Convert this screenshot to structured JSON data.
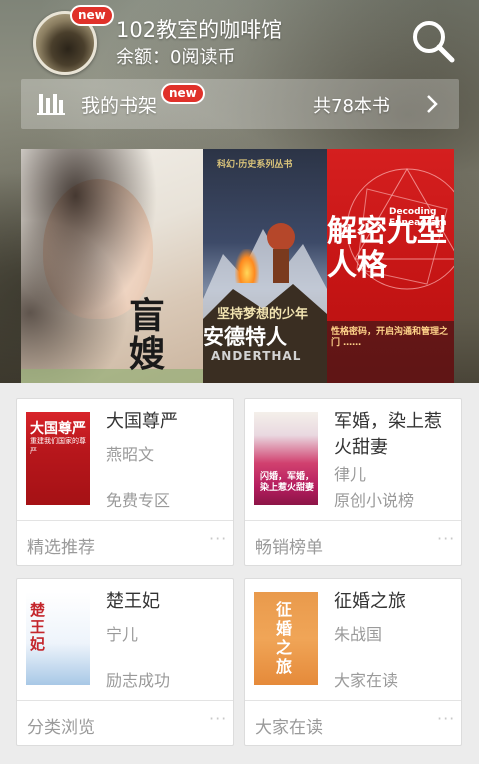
{
  "header": {
    "badge_new": "new",
    "user_name": "102教室的咖啡馆",
    "balance": "余额：0阅读币"
  },
  "shelf": {
    "label": "我的书架",
    "badge_new": "new",
    "count": "共78本书"
  },
  "covers": [
    {
      "title": "盲嫂"
    },
    {
      "top": "科幻·历史系列丛书",
      "motto": "坚持梦想的少年",
      "title": "安德特人",
      "sub": "ANDERTHAL"
    },
    {
      "title": "解密九型人格",
      "en": "Decoding Enneagram",
      "text": "性格密码，开启沟通和管理之门 ……"
    }
  ],
  "cards": [
    {
      "title": "大国尊严",
      "author": "燕昭文",
      "tag": "免费专区",
      "section": "精选推荐",
      "book_text": "大国尊严",
      "book_sub": "重建我们国家的尊严"
    },
    {
      "title": "军婚，染上惹火甜妻",
      "author": "律儿",
      "tag": "原创小说榜",
      "section": "畅销榜单",
      "book_text": "闪婚，军婚，染上惹火甜妻"
    },
    {
      "title": "楚王妃",
      "author": "宁儿",
      "tag": "励志成功",
      "section": "分类浏览",
      "book_text": "楚王妃"
    },
    {
      "title": "征婚之旅",
      "author": "朱战国",
      "tag": "大家在读",
      "section": "大家在读",
      "book_text": "征婚之旅"
    }
  ],
  "more_label": "···",
  "colors": {
    "badge": "#e0312a",
    "muted_text": "#9a9a9a",
    "card_bg": "#ffffff",
    "page_bg": "#ececec"
  },
  "icons": [
    "search-icon",
    "bookshelf-icon",
    "chevron-right-icon"
  ]
}
